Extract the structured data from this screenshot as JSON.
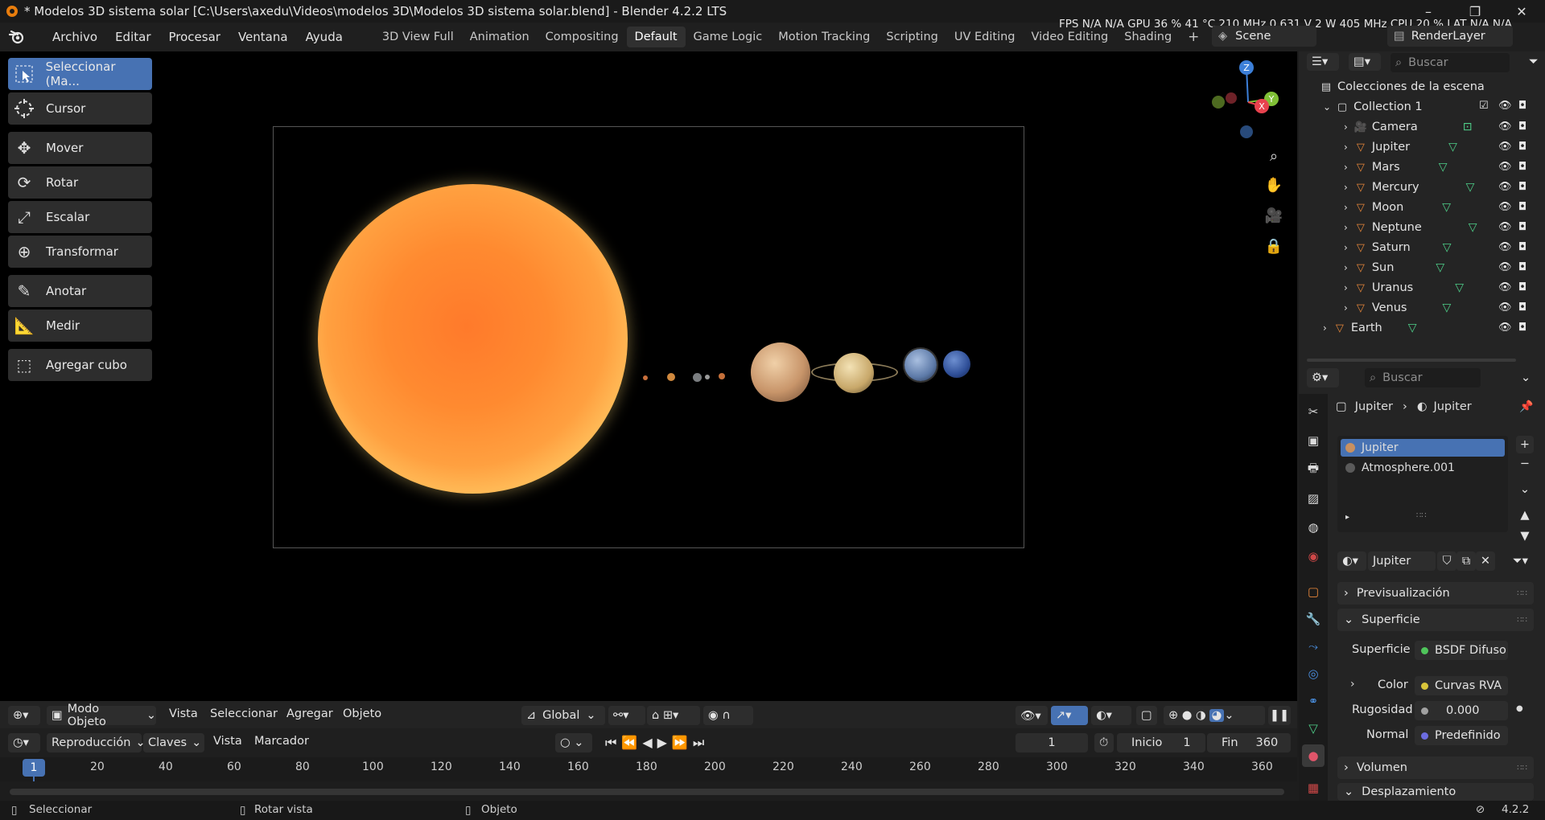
{
  "titlebar": {
    "title": "* Modelos 3D sistema solar [C:\\Users\\axedu\\Videos\\modelos 3D\\Modelos 3D sistema solar.blend] - Blender 4.2.2 LTS",
    "minimize": "–",
    "maximize": "❐",
    "close": "✕"
  },
  "menubar": {
    "menus": [
      "Archivo",
      "Editar",
      "Procesar",
      "Ventana",
      "Ayuda"
    ],
    "workspaces": [
      "3D View Full",
      "Animation",
      "Compositing",
      "Default",
      "Game Logic",
      "Motion Tracking",
      "Scripting",
      "UV Editing",
      "Video Editing",
      "Shading"
    ],
    "active_workspace": "Default",
    "add_tab": "+",
    "scene": "Scene",
    "view_layer": "RenderLayer"
  },
  "stats": "FPS N/A N/A GPU 36 % 41 °C 210 MHz 0.631 V 2 W 405 MHz CPU 20 % LAT N/A N/A",
  "toolbar": {
    "tools": [
      "Seleccionar (Ma...",
      "Cursor",
      "Mover",
      "Rotar",
      "Escalar",
      "Transformar",
      "Anotar",
      "Medir",
      "Agregar cubo"
    ]
  },
  "gizmo": {
    "z": "Z",
    "y": "Y",
    "x": "X"
  },
  "viewport_header": {
    "mode": "Modo Objeto",
    "menus": [
      "Vista",
      "Seleccionar",
      "Agregar",
      "Objeto"
    ],
    "orientation": "Global"
  },
  "timeline": {
    "playback": "Reproducción",
    "keys": "Claves",
    "view": "Vista",
    "marker": "Marcador",
    "current_frame": "1",
    "start_label": "Inicio",
    "start": "1",
    "end_label": "Fin",
    "end": "360",
    "ticks": [
      "1",
      "20",
      "40",
      "60",
      "80",
      "100",
      "120",
      "140",
      "160",
      "180",
      "200",
      "220",
      "240",
      "260",
      "280",
      "300",
      "320",
      "340",
      "360"
    ]
  },
  "statusbar": {
    "select": "Seleccionar",
    "rotate": "Rotar vista",
    "object": "Objeto",
    "version": "4.2.2"
  },
  "outliner": {
    "search_placeholder": "Buscar",
    "root": "Colecciones de la escena",
    "collection": "Collection 1",
    "items": [
      "Camera",
      "Jupiter",
      "Mars",
      "Mercury",
      "Moon",
      "Neptune",
      "Saturn",
      "Sun",
      "Uranus",
      "Venus"
    ],
    "extra": "Earth"
  },
  "properties": {
    "search_placeholder": "Buscar",
    "breadcrumb_object": "Jupiter",
    "breadcrumb_material": "Jupiter",
    "slots": [
      "Jupiter",
      "Atmosphere.001"
    ],
    "material_name": "Jupiter",
    "panels": {
      "preview": "Previsualización",
      "surface": "Superficie",
      "volume": "Volumen",
      "displacement": "Desplazamiento"
    },
    "fields": {
      "surface_label": "Superficie",
      "surface_value": "BSDF Difuso",
      "color_label": "Color",
      "color_value": "Curvas RVA",
      "roughness_label": "Rugosidad",
      "roughness_value": "0.000",
      "normal_label": "Normal",
      "normal_value": "Predefinido"
    }
  },
  "colors": {
    "accent": "#4772b3",
    "orange": "#e87d0d",
    "sun_core": "#ff7a2b",
    "sun_rim": "#fff0a0"
  }
}
